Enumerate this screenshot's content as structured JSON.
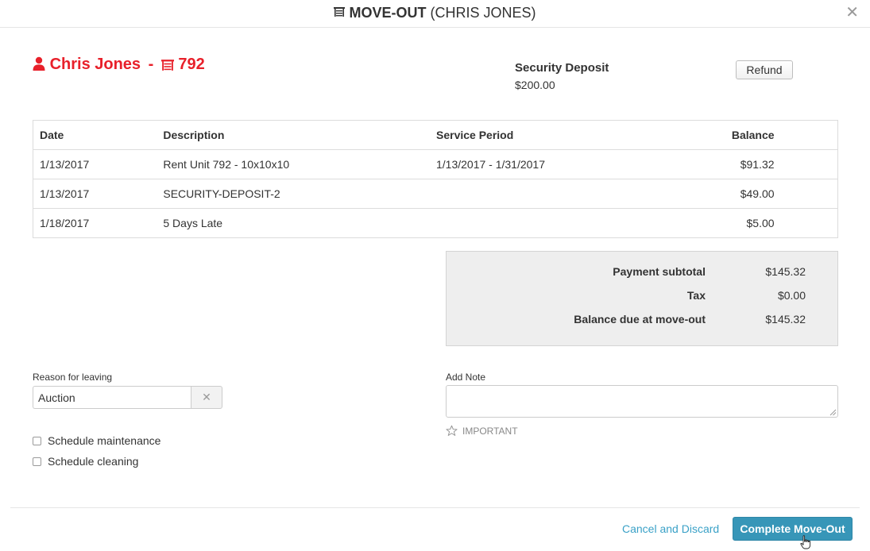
{
  "header": {
    "title_strong": "MOVE-OUT",
    "title_rest": "(CHRIS JONES)",
    "unit_icon": "storage-unit-icon",
    "close_icon": "close-icon",
    "close_glyph": "✕"
  },
  "tenant": {
    "name": "Chris Jones",
    "separator": "-",
    "unit": "792",
    "accent_color": "#e8202a"
  },
  "deposit": {
    "label": "Security Deposit",
    "value": "$200.00",
    "refund_label": "Refund"
  },
  "charges": {
    "columns": [
      "Date",
      "Description",
      "Service Period",
      "Balance"
    ],
    "rows": [
      {
        "date": "1/13/2017",
        "description": "Rent Unit 792 - 10x10x10",
        "period": "1/13/2017 - 1/31/2017",
        "balance": "$91.32"
      },
      {
        "date": "1/13/2017",
        "description": "SECURITY-DEPOSIT-2",
        "period": "",
        "balance": "$49.00"
      },
      {
        "date": "1/18/2017",
        "description": "5 Days Late",
        "period": "",
        "balance": "$5.00"
      }
    ]
  },
  "totals": [
    {
      "label": "Payment subtotal",
      "value": "$145.32"
    },
    {
      "label": "Tax",
      "value": "$0.00"
    },
    {
      "label": "Balance due at move-out",
      "value": "$145.32"
    }
  ],
  "reason": {
    "label": "Reason for leaving",
    "value": "Auction",
    "clear_glyph": "✕"
  },
  "checkboxes": [
    {
      "label": "Schedule maintenance",
      "checked": false
    },
    {
      "label": "Schedule cleaning",
      "checked": false
    }
  ],
  "note": {
    "label": "Add Note",
    "value": "",
    "important_label": "IMPORTANT",
    "star_icon": "star-outline-icon"
  },
  "footer": {
    "cancel_label": "Cancel and Discard",
    "complete_label": "Complete Move-Out",
    "primary_color": "#3796b8",
    "link_color": "#3aa1c7"
  }
}
